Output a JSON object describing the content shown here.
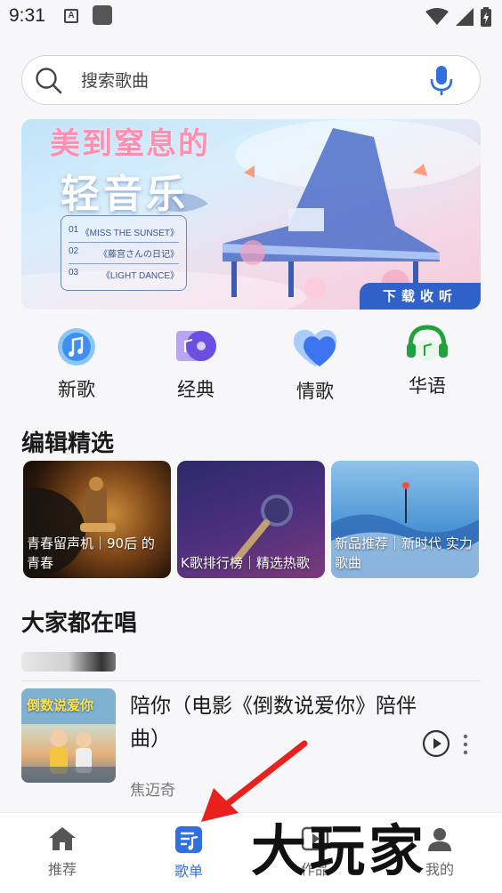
{
  "status_bar": {
    "time": "9:31",
    "badge": "A"
  },
  "search": {
    "placeholder": "搜索歌曲",
    "value": ""
  },
  "banner": {
    "title": "美到窒息的",
    "subtitle": "轻音乐",
    "tracks": [
      {
        "num": "01",
        "name": "《MISS THE SUNSET》"
      },
      {
        "num": "02",
        "name": "《藤宫さんの日记》"
      },
      {
        "num": "03",
        "name": "《LIGHT DANCE》"
      }
    ],
    "download_label": "下载收听"
  },
  "categories": [
    {
      "label": "新歌",
      "icon": "music-note-icon"
    },
    {
      "label": "经典",
      "icon": "vinyl-icon"
    },
    {
      "label": "情歌",
      "icon": "heart-icon"
    },
    {
      "label": "华语",
      "icon": "headphones-icon"
    }
  ],
  "editor_picks": {
    "title": "编辑精选",
    "cards": [
      {
        "caption": "青春留声机｜90后 的青春"
      },
      {
        "caption": "K歌排行榜｜精选热歌"
      },
      {
        "caption": "新品推荐｜新时代 实力歌曲"
      }
    ]
  },
  "everyone_singing": {
    "title": "大家都在唱",
    "songs": [
      {
        "title": "陪你（电影《倒数说爱你》陪伴曲）",
        "artist": "焦迈奇",
        "cover_text": "倒数说爱你"
      }
    ]
  },
  "bottom_nav": {
    "items": [
      {
        "label": "推荐",
        "icon": "home-icon",
        "active": false
      },
      {
        "label": "歌单",
        "icon": "playlist-icon",
        "active": true
      },
      {
        "label": "作品",
        "icon": "video-icon",
        "active": false
      },
      {
        "label": "我的",
        "icon": "profile-icon",
        "active": false
      }
    ]
  },
  "watermark": {
    "text": "大玩家"
  },
  "colors": {
    "accent": "#2f6fe0",
    "annotation": "#e8211c"
  }
}
